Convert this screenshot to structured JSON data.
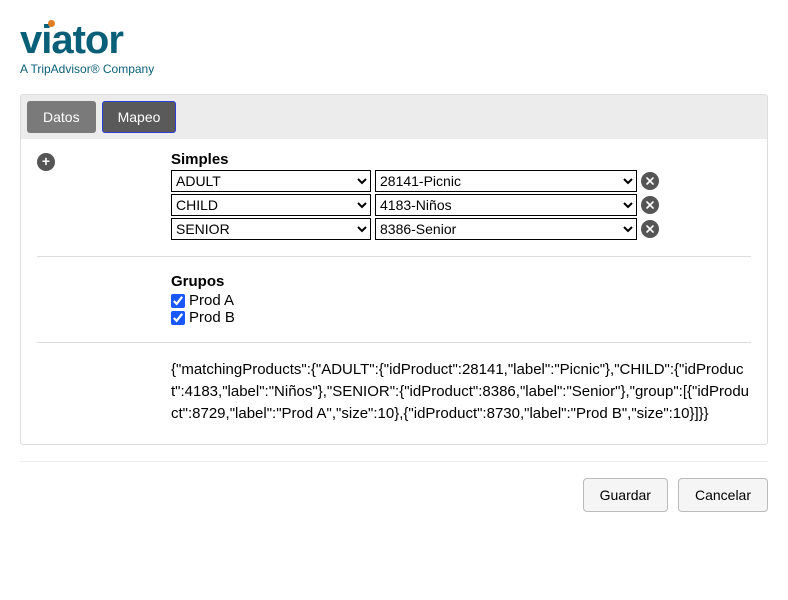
{
  "logo": {
    "wordmark": "viator",
    "tagline": "A TripAdvisor® Company"
  },
  "tabs": {
    "datos": "Datos",
    "mapeo": "Mapeo"
  },
  "sections": {
    "simples": "Simples",
    "grupos": "Grupos"
  },
  "simples_rows": [
    {
      "left": "ADULT",
      "right": "28141-Picnic"
    },
    {
      "left": "CHILD",
      "right": "4183-Niños"
    },
    {
      "left": "SENIOR",
      "right": "8386-Senior"
    }
  ],
  "grupos": [
    {
      "label": "Prod A",
      "checked": true
    },
    {
      "label": "Prod B",
      "checked": true
    }
  ],
  "json_dump": "{\"matchingProducts\":{\"ADULT\":{\"idProduct\":28141,\"label\":\"Picnic\"},\"CHILD\":{\"idProduct\":4183,\"label\":\"Niños\"},\"SENIOR\":{\"idProduct\":8386,\"label\":\"Senior\"},\"group\":[{\"idProduct\":8729,\"label\":\"Prod A\",\"size\":10},{\"idProduct\":8730,\"label\":\"Prod B\",\"size\":10}]}}",
  "buttons": {
    "save": "Guardar",
    "cancel": "Cancelar"
  }
}
